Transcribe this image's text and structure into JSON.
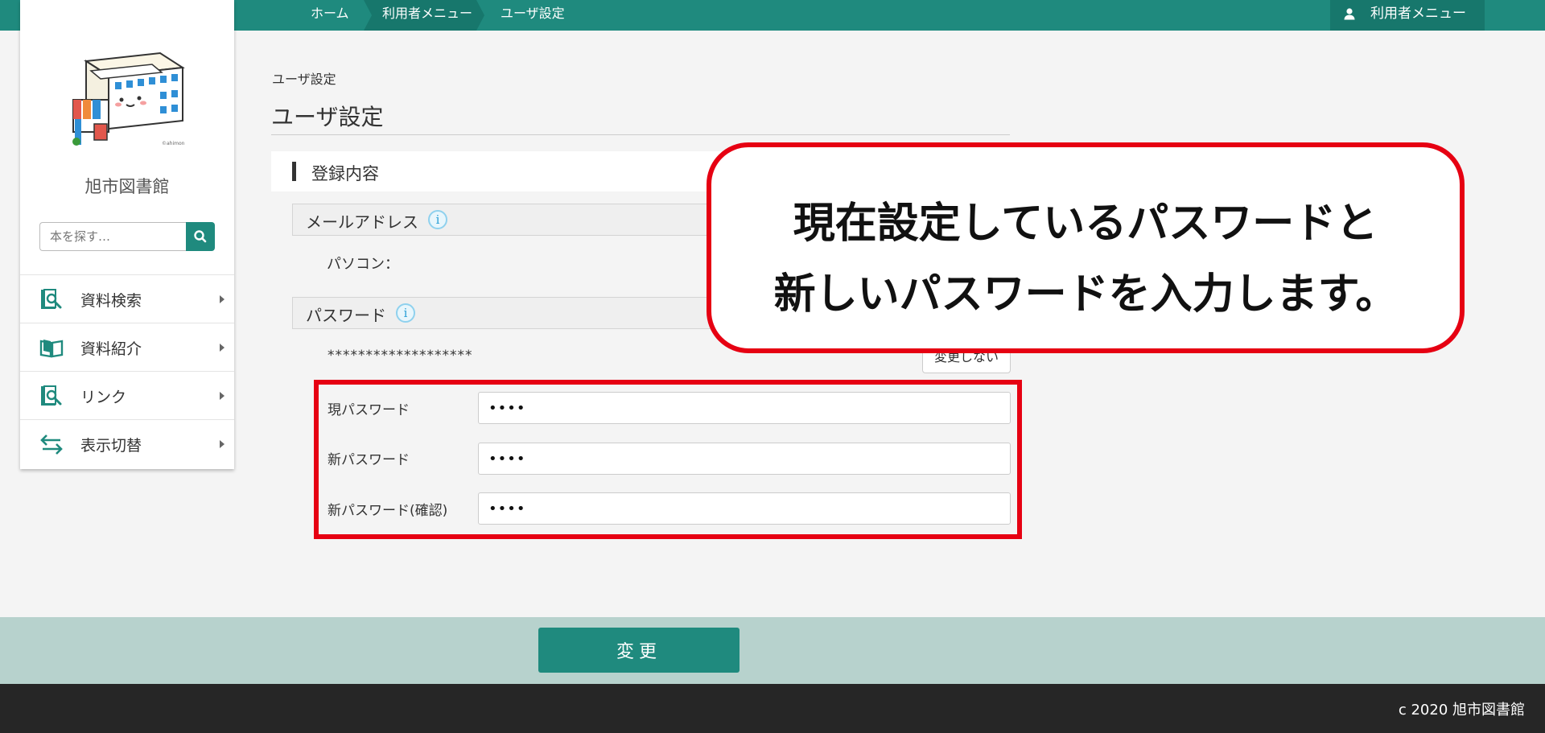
{
  "breadcrumb": {
    "home": "ホーム",
    "user_menu": "利用者メニュー",
    "current": "ユーザ設定"
  },
  "header": {
    "user_menu_label": "利用者メニュー"
  },
  "sidebar": {
    "library_name": "旭市図書館",
    "logo_caption": "©ahimon",
    "search_placeholder": "本を探す…",
    "items": [
      {
        "label": "資料検索",
        "icon": "search-book-icon"
      },
      {
        "label": "資料紹介",
        "icon": "open-book-icon"
      },
      {
        "label": "リンク",
        "icon": "link-search-icon"
      },
      {
        "label": "表示切替",
        "icon": "swap-arrows-icon"
      }
    ]
  },
  "main": {
    "breadcrumb_small": "ユーザ設定",
    "title": "ユーザ設定",
    "section_title": "登録内容",
    "email": {
      "label": "メールアドレス",
      "pc_label": "パソコン："
    },
    "password": {
      "label": "パスワード",
      "masked_value": "*******************",
      "no_change_label": "変更しない",
      "current_label": "現パスワード",
      "current_value": "••••",
      "new_label": "新パスワード",
      "new_value": "••••",
      "confirm_label": "新パスワード(確認)",
      "confirm_value": "••••"
    }
  },
  "callout": {
    "line1": "現在設定しているパスワードと",
    "line2": "新しいパスワードを入力します。"
  },
  "actions": {
    "change_label": "変更"
  },
  "footer": {
    "copyright": "c 2020 旭市図書館"
  },
  "colors": {
    "teal": "#1f8a7e",
    "dark_teal": "#17776c",
    "highlight_red": "#e60012",
    "footer_band": "#b7d2cd",
    "footer_dark": "#262626"
  }
}
